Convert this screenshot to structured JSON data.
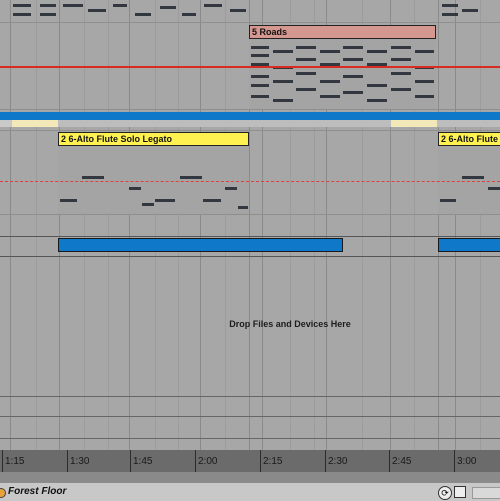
{
  "clips": {
    "roads": {
      "name": "5 Roads",
      "color": "#d49891"
    },
    "flute1": {
      "name": "2 6-Alto Flute Solo Legato",
      "color": "#fff250"
    },
    "flute2": {
      "name": "2 6-Alto Flute",
      "color": "#fff250"
    }
  },
  "drop_zone": {
    "text": "Drop Files and Devices Here"
  },
  "ruler": {
    "labels": [
      "1:15",
      "1:30",
      "1:45",
      "2:00",
      "2:15",
      "2:30",
      "2:45",
      "3:00"
    ]
  },
  "status": {
    "track_name": "Forest Floor"
  },
  "colors": {
    "accent_blue": "#0f78c8",
    "automation_red": "#d82c20",
    "clip_yellow": "#fff250",
    "clip_salmon": "#d49891"
  }
}
